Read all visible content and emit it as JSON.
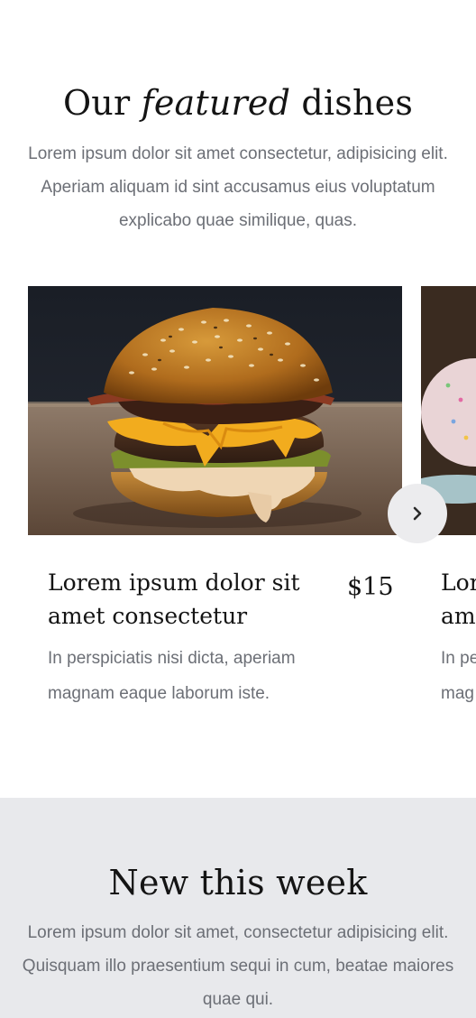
{
  "featured": {
    "title_prefix": "Our ",
    "title_emphasis": "featured",
    "title_suffix": " dishes",
    "description": "Lorem ipsum dolor sit amet consectetur, adipisicing elit. Aperiam aliquam id sint accusamus eius voluptatum explicabo quae similique, quas."
  },
  "dishes": [
    {
      "title": "Lorem ipsum dolor sit amet consectetur",
      "price": "$15",
      "description": "In perspiciatis nisi dicta, aperiam magnam eaque laborum iste.",
      "image_icon": "burger-photo"
    },
    {
      "title": "Lor ame",
      "description": "In pe mag",
      "image_icon": "donut-photo"
    }
  ],
  "carousel": {
    "next_icon": "chevron-right-icon"
  },
  "new_this_week": {
    "title": "New this week",
    "description": "Lorem ipsum dolor sit amet, consectetur adipisicing elit. Quisquam illo praesentium sequi in cum, beatae maiores quae qui."
  },
  "colors": {
    "page_background": "#ffffff",
    "section_background": "#e8e9ec",
    "heading_text": "#141414",
    "body_text": "#6c6f76",
    "button_background": "#ececee"
  }
}
